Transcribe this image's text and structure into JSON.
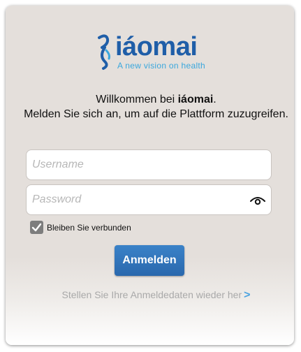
{
  "brand": {
    "name": "iáomai",
    "tagline": "A new vision on health",
    "colors": {
      "primary": "#1f5ea8",
      "accent": "#3aa7dd"
    }
  },
  "welcome": {
    "prefix": "Willkommen bei ",
    "brand": "iáomai",
    "suffix": ".",
    "line2": "Melden Sie sich an, um auf die Plattform zuzugreifen."
  },
  "form": {
    "username": {
      "placeholder": "Username",
      "value": ""
    },
    "password": {
      "placeholder": "Password",
      "value": "",
      "reveal_icon": "eye-icon"
    },
    "remember": {
      "label": "Bleiben Sie verbunden",
      "checked": true
    },
    "submit_label": "Anmelden"
  },
  "restore": {
    "label": "Stellen Sie Ihre Anmeldedaten wieder her",
    "arrow": ">"
  }
}
